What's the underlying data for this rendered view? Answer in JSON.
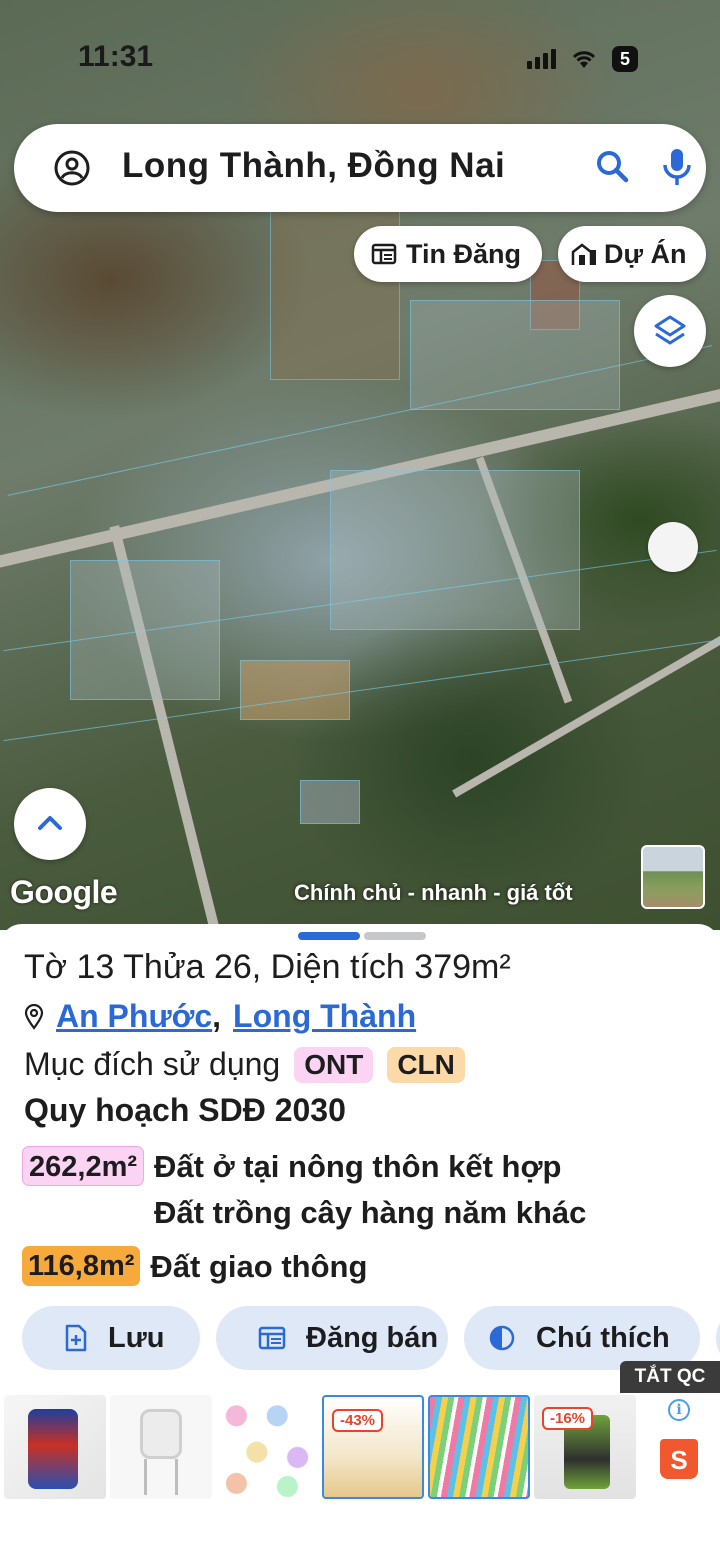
{
  "status": {
    "time": "11:31",
    "battery": "5"
  },
  "search": {
    "query": "Long Thành, Đồng Nai"
  },
  "chips": {
    "tin_dang": "Tin Đăng",
    "du_an": "Dự Án"
  },
  "map": {
    "google": "Google",
    "promo": "Chính chủ - nhanh - giá tốt"
  },
  "parcel": {
    "title": "Tờ 13 Thửa 26, Diện tích 379m²",
    "ward": "An Phước",
    "separator": ",",
    "district": "Long Thành",
    "usage_label": "Mục đích sử dụng",
    "usage_codes": [
      "ONT",
      "CLN"
    ],
    "plan_title": "Quy hoạch SDĐ 2030",
    "plan_items": [
      {
        "area": "262,2m²",
        "lines": [
          "Đất ở tại nông thôn kết hợp",
          "Đất trồng cây hàng năm khác"
        ]
      },
      {
        "area": "116,8m²",
        "lines": [
          "Đất giao thông"
        ]
      }
    ]
  },
  "actions": {
    "save": "Lưu",
    "post": "Đăng bán",
    "legend": "Chú thích"
  },
  "ads": {
    "close": "TẮT QC",
    "x": "✕",
    "discounts": [
      "-43%",
      "-16%"
    ],
    "info": "i",
    "shopee": "S"
  },
  "colors": {
    "accent": "#2b6ad6",
    "ont": "#fbd3f3",
    "cln": "#fbd9a8",
    "action_bg": "#dfe8f7"
  }
}
